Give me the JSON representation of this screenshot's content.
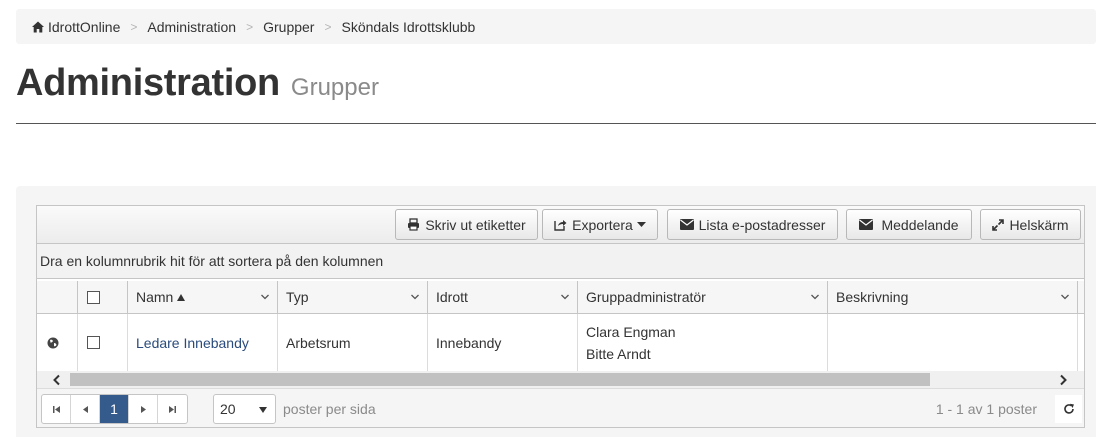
{
  "breadcrumb": {
    "items": [
      "IdrottOnline",
      "Administration",
      "Grupper",
      "Sköndals Idrottsklubb"
    ],
    "separator": ">"
  },
  "header": {
    "title": "Administration",
    "subtitle": "Grupper"
  },
  "toolbar": {
    "print_label": "Skriv ut etiketter",
    "export_label": "Exportera",
    "list_email_label": "Lista e-postadresser",
    "message_label": "Meddelande",
    "fullscreen_label": "Helskärm"
  },
  "grid": {
    "group_hint": "Dra en kolumnrubrik hit för att sortera på den kolumnen",
    "columns": [
      "Namn",
      "Typ",
      "Idrott",
      "Gruppadministratör",
      "Beskrivning"
    ],
    "sorted_column": "Namn",
    "sort_direction": "ascending",
    "rows": [
      {
        "name": "Ledare Innebandy",
        "type": "Arbetsrum",
        "sport": "Innebandy",
        "admins": [
          "Clara Engman",
          "Bitte Arndt"
        ],
        "description": ""
      }
    ]
  },
  "pager": {
    "current_page": "1",
    "page_size": "20",
    "per_page_label": "poster per sida",
    "info": "1 - 1 av 1 poster"
  },
  "colors": {
    "link": "#2a4b7c",
    "active_page": "#355b8c"
  },
  "icons": [
    "home-icon",
    "print-icon",
    "export-icon",
    "envelope-icon",
    "expand-icon",
    "globe-icon",
    "refresh-icon"
  ]
}
